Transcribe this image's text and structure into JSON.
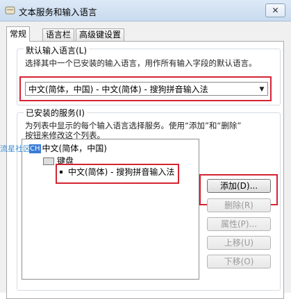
{
  "window": {
    "title": "文本服务和输入语言",
    "close_glyph": "✕"
  },
  "tabs": [
    {
      "label": "常规",
      "active": true
    },
    {
      "label": "语言栏",
      "active": false
    },
    {
      "label": "高级键设置",
      "active": false
    }
  ],
  "default_language": {
    "legend": "默认输入语言(L)",
    "description": "选择其中一个已安装的输入语言，用作所有输入字段的默认语言。",
    "selected": "中文(简体，中国) - 中文(简体) - 搜狗拼音输入法"
  },
  "installed_services": {
    "legend": "已安装的服务(I)",
    "description_line1": "为列表中显示的每个输入语言选择服务。使用“添加”和“删除”",
    "description_line2": "按钮来修改这个列表。",
    "tree": {
      "language_badge": "CH",
      "language": "中文(简体，中国)",
      "category": "键盘",
      "service": "中文(简体) - 搜狗拼音输入法"
    }
  },
  "buttons": {
    "add": "添加(D)...",
    "remove": "删除(R)",
    "properties": "属性(P)...",
    "move_up": "上移(U)",
    "move_down": "下移(O)"
  },
  "watermark": "流星社区",
  "colors": {
    "highlight_box": "#d42332",
    "badge": "#3a7bd5"
  }
}
